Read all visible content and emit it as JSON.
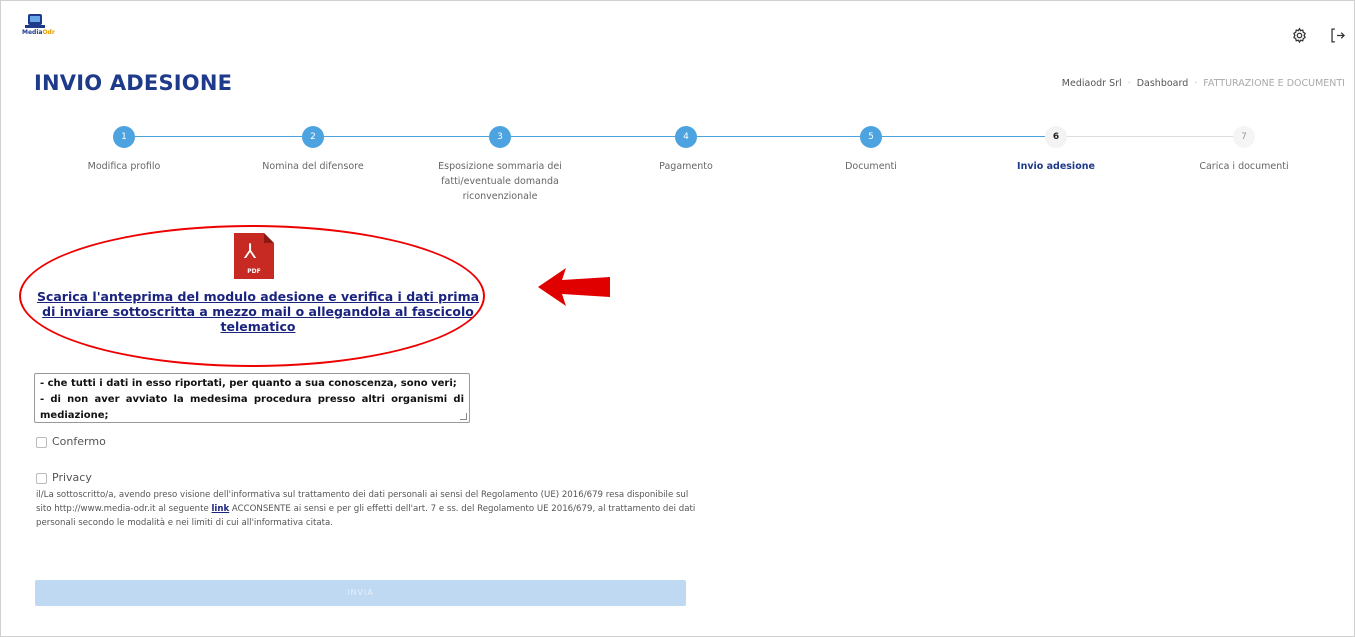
{
  "app": {
    "logo_text_a": "Media",
    "logo_text_b": "Odr"
  },
  "header": {
    "settings_icon": "⚙",
    "logout_icon": "→"
  },
  "page_title": "INVIO ADESIONE",
  "breadcrumb": [
    "Mediaodr Srl",
    "Dashboard",
    "FATTURAZIONE E DOCUMENTI"
  ],
  "steps": [
    {
      "num": "1",
      "label": "Modifica profilo",
      "state": "done"
    },
    {
      "num": "2",
      "label": "Nomina del difensore",
      "state": "done"
    },
    {
      "num": "3",
      "label": "Esposizione sommaria dei fatti/eventuale domanda riconvenzionale",
      "state": "done"
    },
    {
      "num": "4",
      "label": "Pagamento",
      "state": "done"
    },
    {
      "num": "5",
      "label": "Documenti",
      "state": "done"
    },
    {
      "num": "6",
      "label": "Invio adesione",
      "state": "current"
    },
    {
      "num": "7",
      "label": "Carica i documenti",
      "state": "future"
    }
  ],
  "pdf": {
    "icon": "pdf-file-icon",
    "tag": "PDF"
  },
  "download_link": "Scarica l'anteprima del modulo adesione e verifica i dati prima di inviare sottoscritta a mezzo mail o allegandola al fascicolo telematico",
  "declaration_text": {
    "line1": "- che tutti i dati in esso riportati, per quanto a sua conoscenza, sono veri;",
    "line2": "- di non aver avviato la medesima procedura presso altri organismi di",
    "line3": "mediazione;"
  },
  "confirm_label": "Confermo",
  "privacy": {
    "label": "Privacy",
    "text_before": "il/La sottoscritto/a, avendo preso visione dell'informativa sul trattamento dei dati personali ai sensi del Regolamento (UE) 2016/679 resa disponibile sul sito http://www.media-odr.it al seguente ",
    "link": "link",
    "text_after": " ACCONSENTE ai sensi e per gli effetti dell'art. 7 e ss. del Regolamento UE 2016/679, al trattamento dei dati personali secondo le modalità e nei limiti di cui all'informativa citata."
  },
  "submit_label": "INVIA",
  "colors": {
    "brand": "#1e3a8a",
    "step_active": "#4da3df",
    "annotation": "#e00000",
    "submit_disabled": "#bfd9f3"
  }
}
